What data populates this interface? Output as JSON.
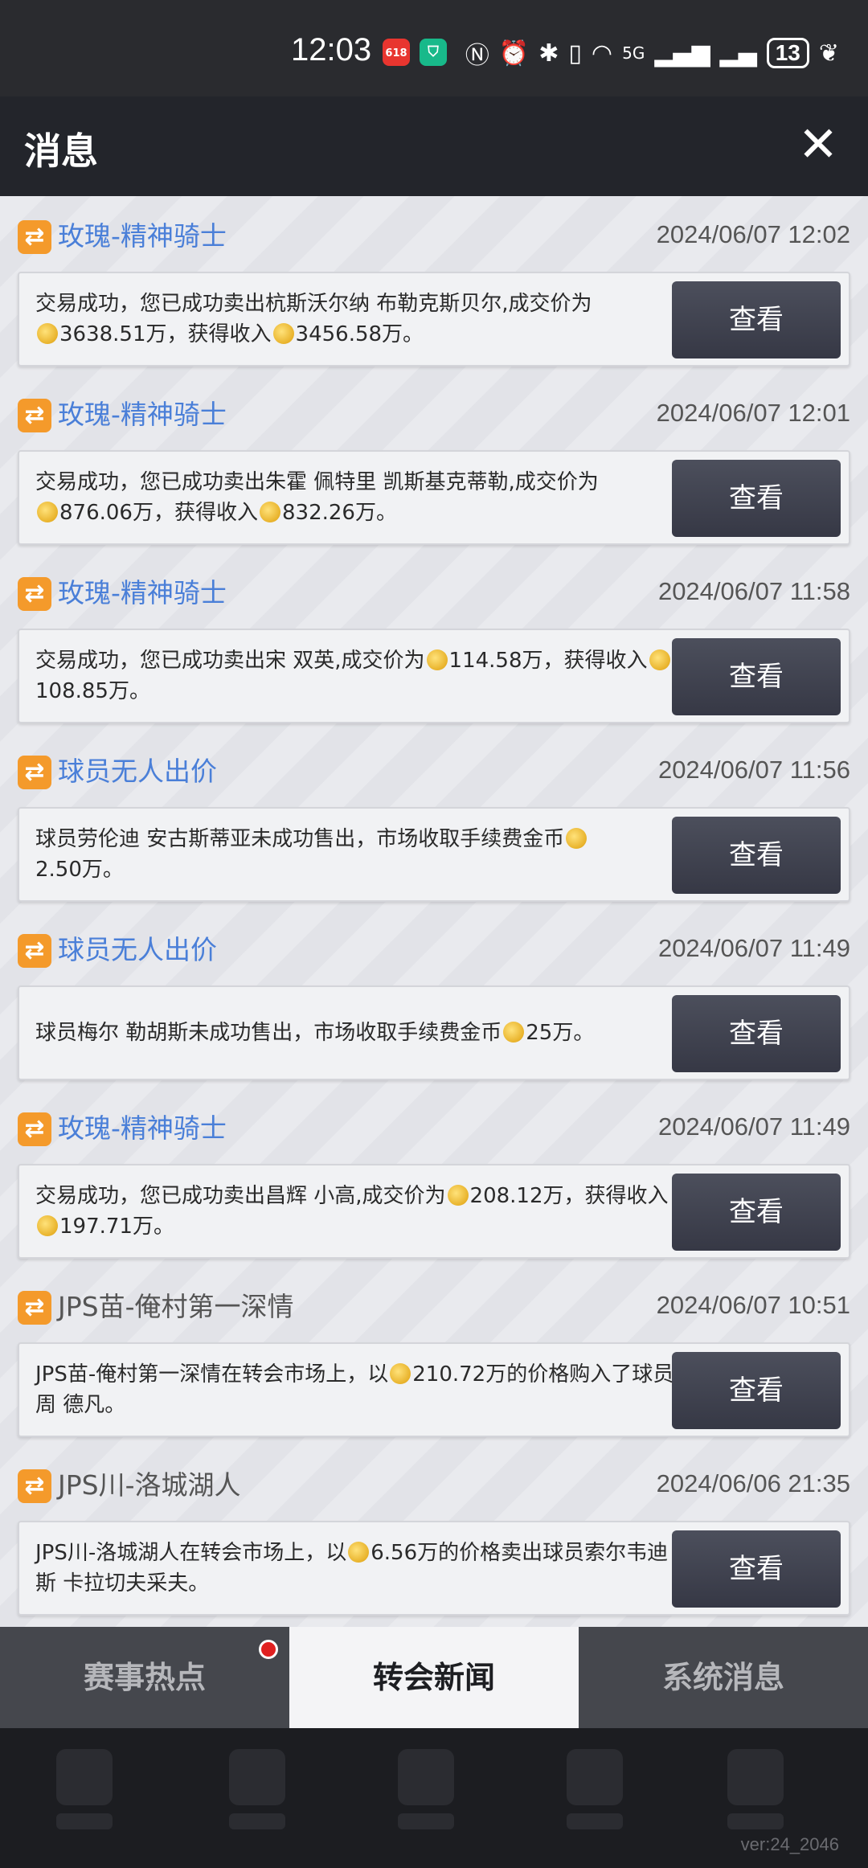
{
  "status_bar": {
    "time": "12:03",
    "app_badge_1": "618",
    "battery": "13",
    "network": "5G"
  },
  "header": {
    "title": "消息",
    "close_icon": "close-icon"
  },
  "messages": [
    {
      "sender": "玫瑰-精神骑士",
      "time": "2024/06/07 12:02",
      "text_a": "交易成功，您已成功卖出杭斯沃尔纳 布勒克斯贝尔,成交价为",
      "text_b": "3638.51万，获得收入",
      "text_c": "3456.58万。",
      "button": "查看"
    },
    {
      "sender": "玫瑰-精神骑士",
      "time": "2024/06/07 12:01",
      "text_a": "交易成功，您已成功卖出朱霍 佩特里 凯斯基克蒂勒,成交价为",
      "text_b": "876.06万，获得收入",
      "text_c": "832.26万。",
      "button": "查看"
    },
    {
      "sender": "玫瑰-精神骑士",
      "time": "2024/06/07 11:58",
      "text_a": "交易成功，您已成功卖出宋 双英,成交价为",
      "text_b": "114.58万，获得收入",
      "text_c": "108.85万。",
      "button": "查看"
    },
    {
      "sender": "球员无人出价",
      "time": "2024/06/07 11:56",
      "text_a": "球员劳伦迪 安古斯蒂亚未成功售出，市场收取手续费金币",
      "text_b": "2.50万。",
      "button": "查看"
    },
    {
      "sender": "球员无人出价",
      "time": "2024/06/07 11:49",
      "text_a": "球员梅尔 勒胡斯未成功售出，市场收取手续费金币",
      "text_b": "25万。",
      "button": "查看"
    },
    {
      "sender": "玫瑰-精神骑士",
      "time": "2024/06/07 11:49",
      "text_a": "交易成功，您已成功卖出昌辉 小高,成交价为",
      "text_b": "208.12万，获得收入",
      "text_c": "197.71万。",
      "button": "查看"
    },
    {
      "sender": "JPS苗-俺村第一深情",
      "time": "2024/06/07 10:51",
      "text_a": "JPS苗-俺村第一深情在转会市场上，以",
      "text_b": "210.72万的价格购入了球员周 德凡。",
      "button": "查看"
    },
    {
      "sender": "JPS川-洛城湖人",
      "time": "2024/06/06 21:35",
      "text_a": "JPS川-洛城湖人在转会市场上，以",
      "text_b": "6.56万的价格卖出球员索尔韦迪斯 卡拉切夫采夫。",
      "button": "查看"
    }
  ],
  "tabs": [
    {
      "label": "赛事热点",
      "active": false,
      "has_dot": true
    },
    {
      "label": "转会新闻",
      "active": true,
      "has_dot": false
    },
    {
      "label": "系统消息",
      "active": false,
      "has_dot": false
    }
  ],
  "version": "ver:24_2046",
  "colors": {
    "sender_blue": "#4a7fd8",
    "icon_orange": "#f49a2b",
    "button_dark": "#3f424f",
    "notify_red": "#e02020"
  }
}
